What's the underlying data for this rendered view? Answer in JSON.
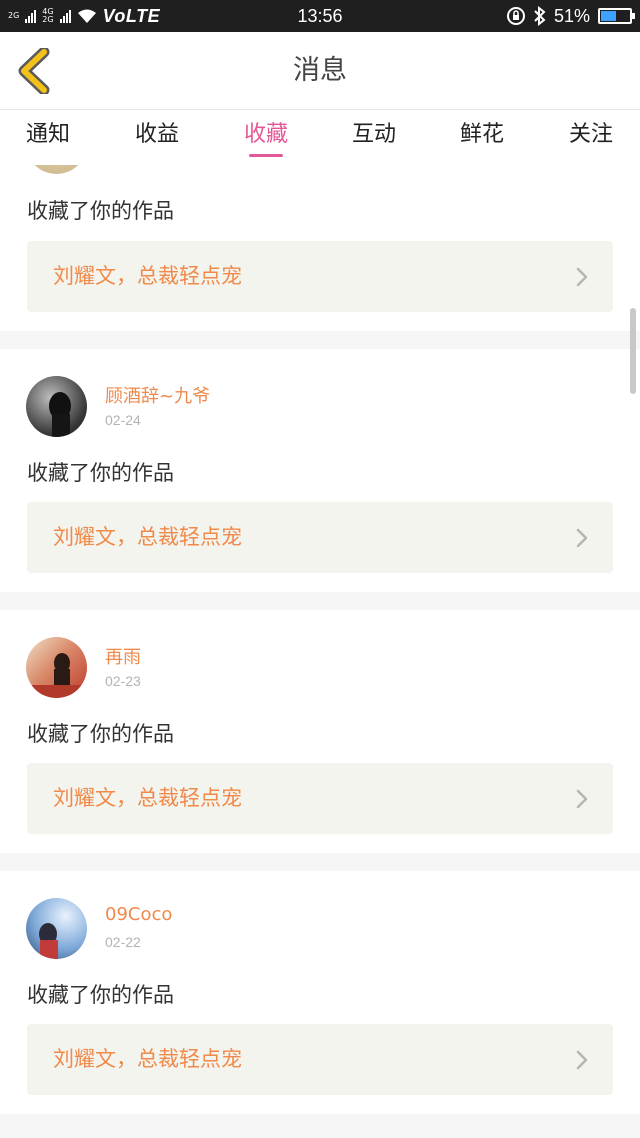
{
  "status_bar": {
    "sim1": "2G",
    "sim2a": "4G",
    "sim2b": "2G",
    "volte": "VoLTE",
    "time": "13:56",
    "battery_text": "51%",
    "battery_level": 0.51
  },
  "header": {
    "title": "消息"
  },
  "tabs": [
    {
      "label": "通知"
    },
    {
      "label": "收益"
    },
    {
      "label": "收藏",
      "active": true
    },
    {
      "label": "互动"
    },
    {
      "label": "鲜花"
    },
    {
      "label": "关注"
    }
  ],
  "items": [
    {
      "action": "收藏了你的作品",
      "work_title": "刘耀文，总裁轻点宠"
    },
    {
      "user": "顾酒辞~九爷",
      "date": "02-24",
      "action": "收藏了你的作品",
      "work_title": "刘耀文，总裁轻点宠"
    },
    {
      "user": "再雨",
      "date": "02-23",
      "action": "收藏了你的作品",
      "work_title": "刘耀文，总裁轻点宠"
    },
    {
      "user": "09Coco",
      "date": "02-22",
      "action": "收藏了你的作品",
      "work_title": "刘耀文，总裁轻点宠"
    }
  ],
  "colors": {
    "accent_pink": "#e35896",
    "accent_orange": "#f08a4b",
    "back_arrow": "#f2c21b"
  }
}
